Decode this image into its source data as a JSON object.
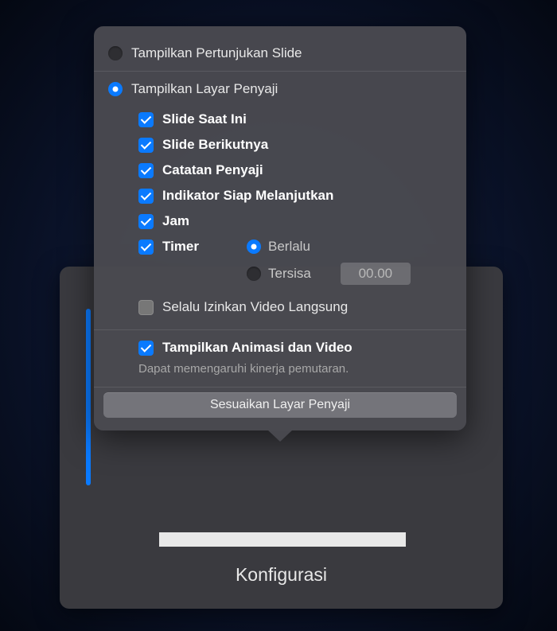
{
  "backPanel": {
    "label": "Konfigurasi"
  },
  "popover": {
    "radios": {
      "showSlideshow": "Tampilkan Pertunjukan Slide",
      "showPresenterDisplay": "Tampilkan Layar Penyaji"
    },
    "checkboxes": {
      "currentSlide": "Slide Saat Ini",
      "nextSlide": "Slide Berikutnya",
      "presenterNotes": "Catatan Penyaji",
      "readyIndicator": "Indikator Siap Melanjutkan",
      "clock": "Jam",
      "timer": "Timer",
      "allowLiveVideo": "Selalu Izinkan Video Langsung",
      "showAnimations": "Tampilkan Animasi dan Video"
    },
    "timerOptions": {
      "elapsed": "Berlalu",
      "remaining": "Tersisa",
      "timeValue": "00.00"
    },
    "hint": "Dapat memengaruhi kinerja pemutaran.",
    "customizeButton": "Sesuaikan Layar Penyaji"
  }
}
